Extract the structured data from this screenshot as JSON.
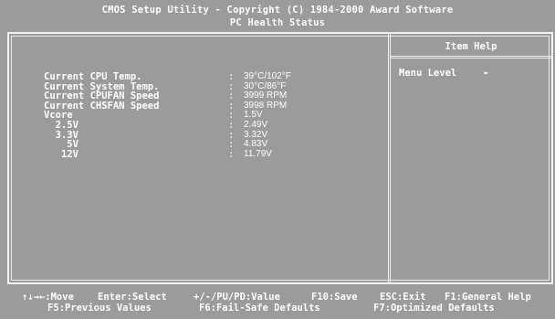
{
  "header": {
    "title": "CMOS Setup Utility - Copyright (C) 1984-2000 Award Software",
    "subtitle": "PC Health Status"
  },
  "items": [
    {
      "label": "Current CPU Temp.",
      "value": "39°C/102°F"
    },
    {
      "label": "Current System Temp.",
      "value": "30°C/86°F"
    },
    {
      "label": "Current CPUFAN Speed",
      "value": "3999 RPM"
    },
    {
      "label": "Current CHSFAN Speed",
      "value": "3998 RPM"
    },
    {
      "label": "Vcore",
      "value": "1.5V"
    },
    {
      "label": "  2.5V",
      "value": "2.49V"
    },
    {
      "label": "  3.3V",
      "value": "3.32V"
    },
    {
      "label": "    5V",
      "value": "4.83V"
    },
    {
      "label": "   12V",
      "value": "11.79V"
    }
  ],
  "colon": ":",
  "help": {
    "title": "Item Help",
    "menu_level_label": "Menu Level",
    "menu_level_arrow": "►"
  },
  "footer": {
    "line1": [
      "↑↓→←:Move",
      "Enter:Select",
      "+/-/PU/PD:Value",
      "F10:Save",
      "ESC:Exit",
      "F1:General Help"
    ],
    "line2": [
      "F5:Previous Values",
      "F6:Fail-Safe Defaults",
      "F7:Optimized Defaults"
    ]
  },
  "colors": {
    "background": "#9b9b9b",
    "text": "#ffffff",
    "frame": "#f2f2f2"
  }
}
